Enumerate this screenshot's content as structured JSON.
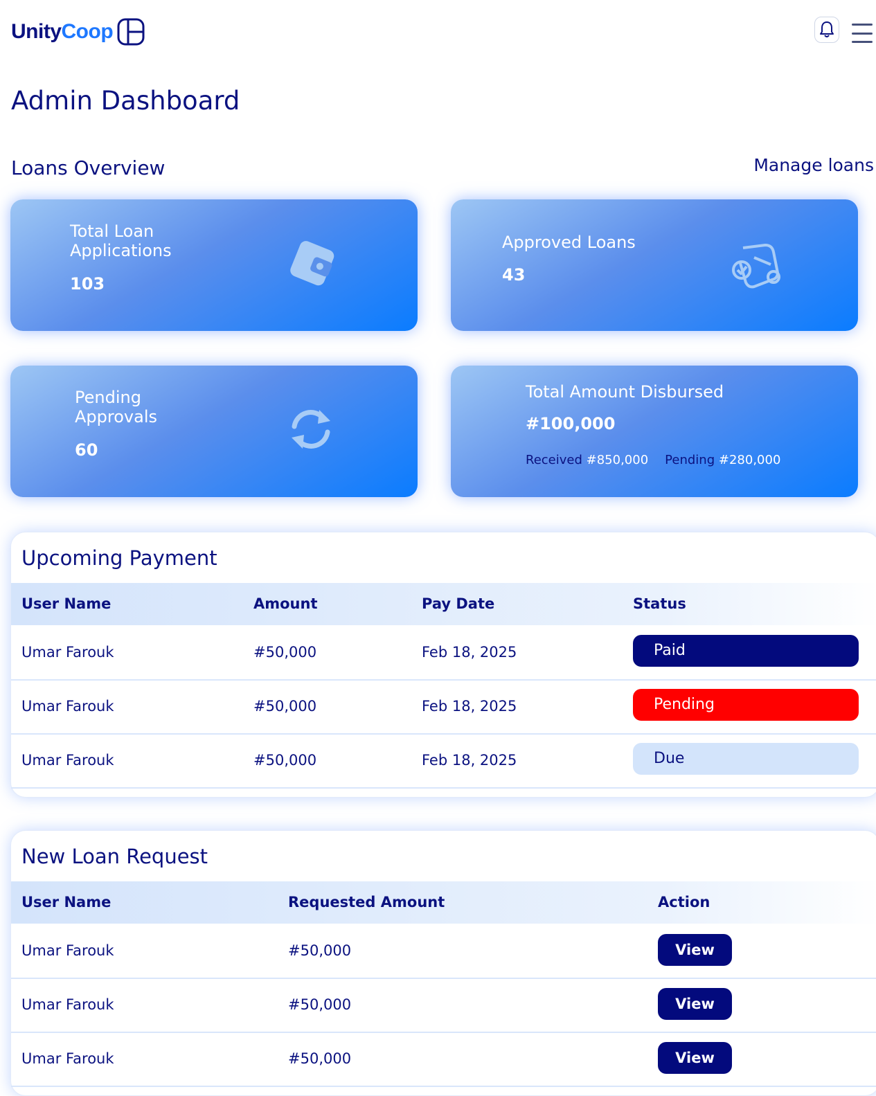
{
  "header": {
    "logo_part1": "Unity",
    "logo_part2": "Coop"
  },
  "page_title": "Admin Dashboard",
  "loans_overview": {
    "title": "Loans Overview",
    "manage_link": "Manage loans",
    "cards": {
      "total_applications": {
        "label_line1": "Total Loan",
        "label_line2": "Applications",
        "value": "103",
        "icon": "wallet-icon"
      },
      "approved": {
        "label": "Approved Loans",
        "value": "43",
        "icon": "approved-loan-icon"
      },
      "pending": {
        "label_line1": "Pending",
        "label_line2": "Approvals",
        "value": "60",
        "icon": "refresh-icon"
      },
      "disbursed": {
        "label": "Total Amount Disbursed",
        "value": "#100,000",
        "received_label": "Received",
        "received_value": "#850,000",
        "pending_label": "Pending",
        "pending_value": "#280,000"
      }
    }
  },
  "upcoming_payment": {
    "title": "Upcoming Payment",
    "columns": {
      "user": "User Name",
      "amount": "Amount",
      "date": "Pay Date",
      "status": "Status"
    },
    "rows": [
      {
        "user": "Umar Farouk",
        "amount": "#50,000",
        "date": "Feb 18, 2025",
        "status": "Paid"
      },
      {
        "user": "Umar Farouk",
        "amount": "#50,000",
        "date": "Feb 18, 2025",
        "status": "Pending"
      },
      {
        "user": "Umar Farouk",
        "amount": "#50,000",
        "date": "Feb 18, 2025",
        "status": "Due"
      }
    ],
    "status_colors": {
      "paid": "#030a7d",
      "pending": "#ff0000",
      "due": "#d3e4fb"
    }
  },
  "new_loan_request": {
    "title": "New Loan Request",
    "columns": {
      "user": "User Name",
      "amount": "Requested Amount",
      "action": "Action"
    },
    "rows": [
      {
        "user": "Umar Farouk",
        "amount": "#50,000",
        "action": "View"
      },
      {
        "user": "Umar Farouk",
        "amount": "#50,000",
        "action": "View"
      },
      {
        "user": "Umar Farouk",
        "amount": "#50,000",
        "action": "View"
      }
    ]
  },
  "colors": {
    "brand_navy": "#0b1280",
    "brand_blue": "#1e78ff",
    "card_gradient_end": "#0a7cff"
  }
}
